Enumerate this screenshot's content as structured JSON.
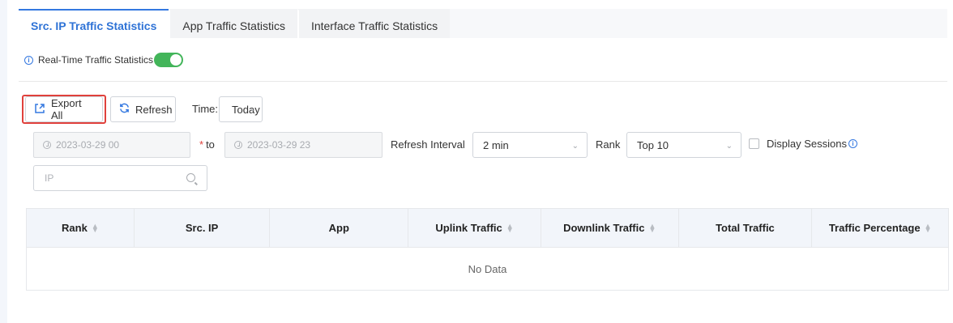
{
  "tabs": [
    {
      "label": "Src. IP Traffic Statistics",
      "active": true
    },
    {
      "label": "App Traffic Statistics",
      "active": false
    },
    {
      "label": "Interface Traffic Statistics",
      "active": false
    }
  ],
  "realtime": {
    "info_icon": "info-icon",
    "label": "Real-Time Traffic Statistics",
    "enabled": true,
    "toggle_color": "#43b55a"
  },
  "toolbar": {
    "export_label": "Export All",
    "export_icon": "export-icon",
    "refresh_label": "Refresh",
    "refresh_icon": "refresh-icon",
    "time_label": "Time:",
    "time_value": "Today"
  },
  "filters": {
    "start_date": "2023-03-29 00",
    "to_label": "to",
    "required_mark": "*",
    "end_date": "2023-03-29 23",
    "refresh_interval_label": "Refresh Interval",
    "refresh_interval_value": "2 min",
    "rank_label": "Rank",
    "rank_value": "Top 10",
    "display_sessions_label": "Display Sessions",
    "display_sessions_checked": false,
    "ip_placeholder": "IP"
  },
  "table": {
    "columns": [
      {
        "label": "Rank",
        "sortable": true
      },
      {
        "label": "Src. IP",
        "sortable": false
      },
      {
        "label": "App",
        "sortable": false
      },
      {
        "label": "Uplink Traffic",
        "sortable": true
      },
      {
        "label": "Downlink Traffic",
        "sortable": true
      },
      {
        "label": "Total Traffic",
        "sortable": false
      },
      {
        "label": "Traffic Percentage",
        "sortable": true
      }
    ],
    "empty_text": "No Data"
  },
  "colors": {
    "accent": "#3478e0",
    "highlight": "#e0413c"
  }
}
